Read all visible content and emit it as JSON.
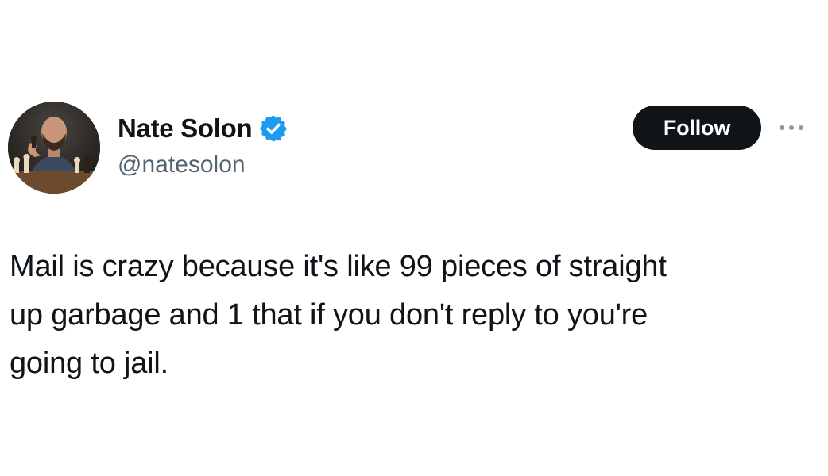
{
  "author": {
    "display_name": "Nate Solon",
    "handle": "@natesolon",
    "verified": true,
    "avatar_icon": "avatar-chess-player"
  },
  "actions": {
    "follow_label": "Follow",
    "more_icon": "more-horizontal-icon"
  },
  "tweet": {
    "text": "Mail is crazy because it's like 99 pieces of straight\nup garbage and 1 that if you don't reply to you're\ngoing to jail."
  },
  "colors": {
    "verified_blue": "#1d9bf0",
    "follow_bg": "#0f1419",
    "handle_gray": "#536471"
  }
}
